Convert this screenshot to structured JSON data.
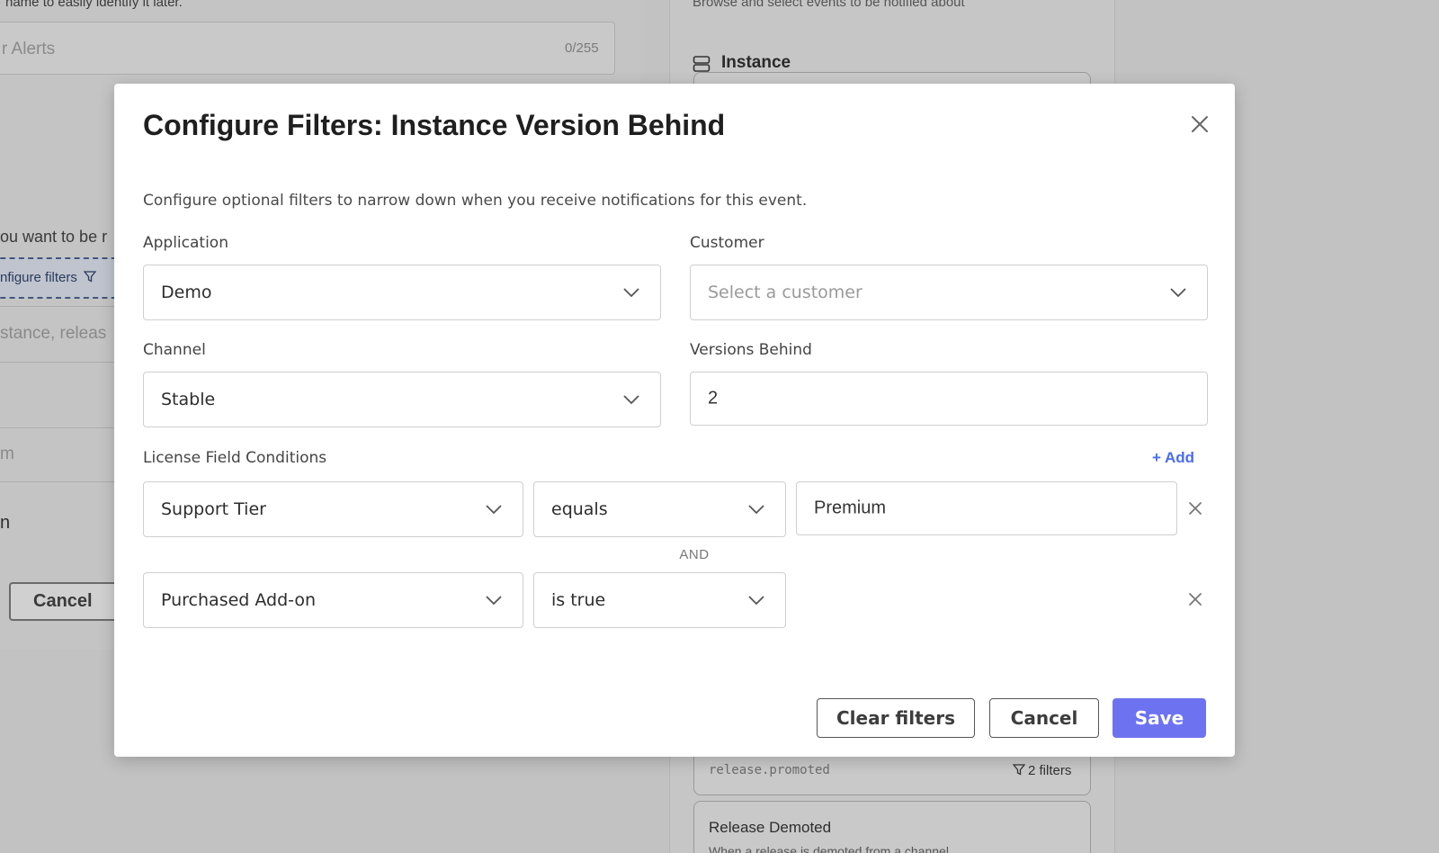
{
  "background": {
    "hint_text": "name to easily identify it later.",
    "name_placeholder": "r Alerts",
    "name_counter": "0/255",
    "notify_text": "ou want to be r",
    "configure_filters_link": "nfigure filters",
    "search_placeholder": "stance, releas",
    "partial_m": "m",
    "partial_n": "n",
    "cancel_label": "Cancel",
    "browse_text": "Browse and select events to be notified about",
    "instance_heading": "Instance",
    "event_code": "release.promoted",
    "filters_badge": "2 filters",
    "release_demoted_title": "Release Demoted",
    "release_demoted_desc": "When a release is demoted from a channel"
  },
  "modal": {
    "title": "Configure Filters: Instance Version Behind",
    "description": "Configure optional filters to narrow down when you receive notifications for this event.",
    "application": {
      "label": "Application",
      "value": "Demo"
    },
    "customer": {
      "label": "Customer",
      "placeholder": "Select a customer"
    },
    "channel": {
      "label": "Channel",
      "value": "Stable"
    },
    "versions_behind": {
      "label": "Versions Behind",
      "value": "2"
    },
    "license_conditions": {
      "label": "License Field Conditions",
      "add_label": "+ Add",
      "joiner": "AND",
      "rows": [
        {
          "field": "Support Tier",
          "operator": "equals",
          "value": "Premium"
        },
        {
          "field": "Purchased Add-on",
          "operator": "is true"
        }
      ]
    },
    "buttons": {
      "clear": "Clear filters",
      "cancel": "Cancel",
      "save": "Save"
    }
  },
  "colors": {
    "primary": "#6d73f0",
    "link": "#4a6cf0",
    "overlay": "#c2c2c2"
  },
  "icons": [
    "close-icon",
    "chevron-down-icon",
    "filter-icon",
    "server-icon"
  ]
}
